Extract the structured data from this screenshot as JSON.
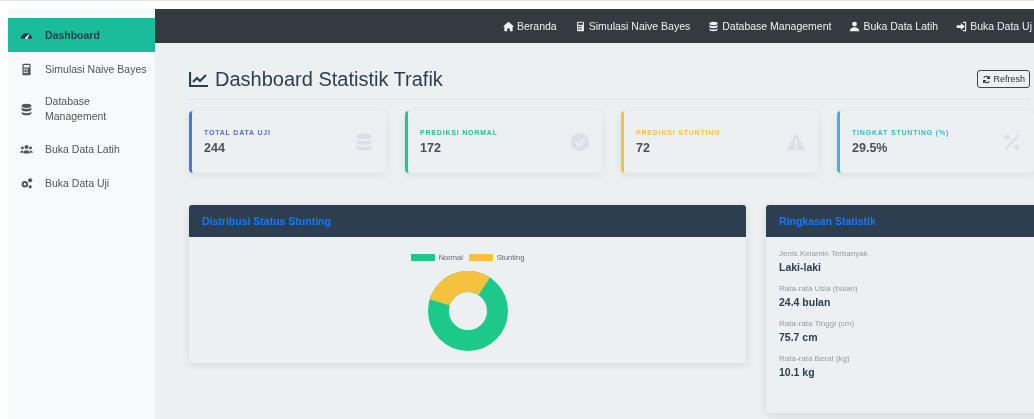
{
  "sidebar": {
    "items": [
      {
        "label": "Dashboard",
        "selected": true
      },
      {
        "label": "Simulasi Naive Bayes",
        "selected": false
      },
      {
        "label": "Database Management",
        "selected": false
      },
      {
        "label": "Buka Data Latih",
        "selected": false
      },
      {
        "label": "Buka Data Uji",
        "selected": false
      }
    ]
  },
  "navbar": {
    "items": [
      {
        "label": "Beranda"
      },
      {
        "label": "Simulasi Naive Bayes"
      },
      {
        "label": "Database Management"
      },
      {
        "label": "Buka Data Latih"
      },
      {
        "label": "Buka Data Uj"
      }
    ]
  },
  "page": {
    "title": "Dashboard Statistik Trafik",
    "refresh_button": "Refresh"
  },
  "cards": [
    {
      "label": "TOTAL DATA UJI",
      "value": "244",
      "color": "#4e73df"
    },
    {
      "label": "PREDIKSI NORMAL",
      "value": "172",
      "color": "#1cc88a"
    },
    {
      "label": "PREDIKSI STUNTING",
      "value": "72",
      "color": "#f6c23e"
    },
    {
      "label": "TINGKAT STUNTING (%)",
      "value": "29.5%",
      "color": "#36b9cc"
    }
  ],
  "distribution_panel": {
    "title": "Distribusi Status Stunting",
    "legend": [
      {
        "label": "Normal",
        "color": "#1cc88a"
      },
      {
        "label": "Stunting",
        "color": "#f6c23e"
      }
    ]
  },
  "summary_panel": {
    "title": "Ringkasan Statistik",
    "stats": [
      {
        "label": "Jenis Kelamin Terbanyak",
        "value": "Laki-laki"
      },
      {
        "label": "Rata-rata Usia (bulan)",
        "value": "24.4 bulan"
      },
      {
        "label": "Rata-rata Tinggi (cm)",
        "value": "75.7 cm"
      },
      {
        "label": "Rata-rata Berat (kg)",
        "value": "10.1 kg"
      }
    ]
  }
}
